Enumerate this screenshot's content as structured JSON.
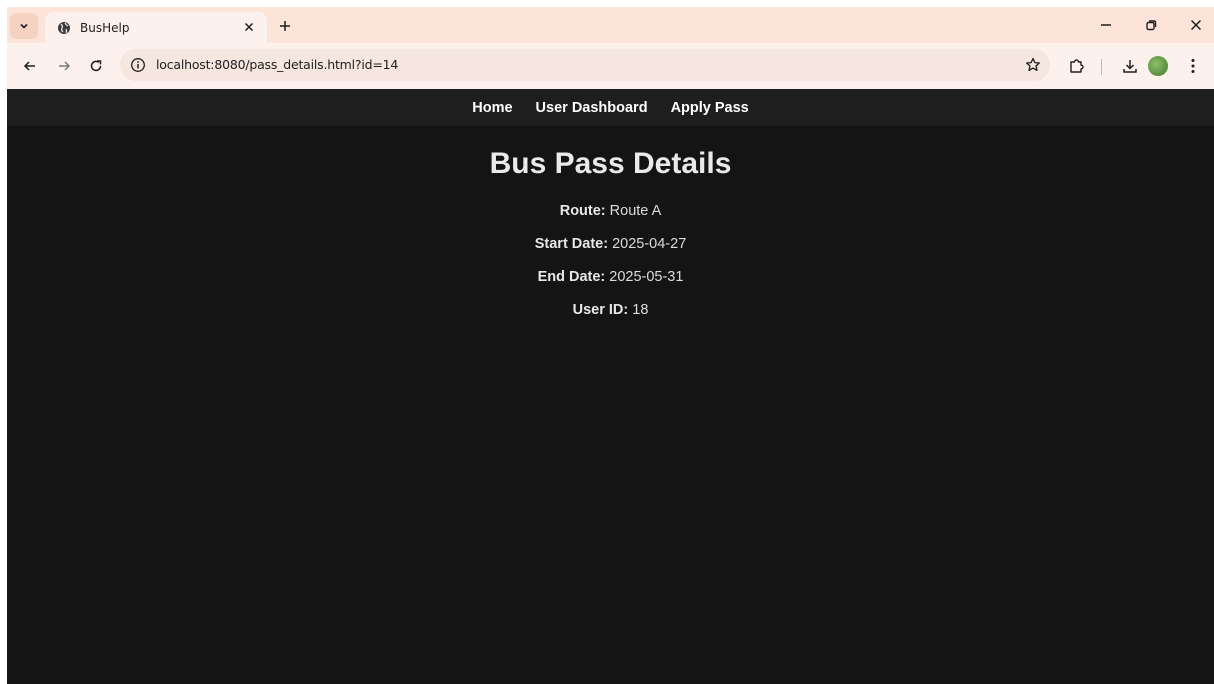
{
  "browser": {
    "tab_title": "BusHelp",
    "url": "localhost:8080/pass_details.html?id=14",
    "new_tab_label": "+"
  },
  "navbar": {
    "items": [
      {
        "label": "Home"
      },
      {
        "label": "User Dashboard"
      },
      {
        "label": "Apply Pass"
      }
    ]
  },
  "main": {
    "title": "Bus Pass Details",
    "details": [
      {
        "label": "Route:",
        "value": "Route A"
      },
      {
        "label": "Start Date:",
        "value": "2025-04-27"
      },
      {
        "label": "End Date:",
        "value": "2025-05-31"
      },
      {
        "label": "User ID:",
        "value": "18"
      }
    ]
  },
  "colors": {
    "tabstrip": "#fde4d8",
    "toolbar": "#fcf1ec",
    "page_bg": "#141414",
    "navbar_bg": "#1e1e1e",
    "nav_text": "#ffffff"
  }
}
